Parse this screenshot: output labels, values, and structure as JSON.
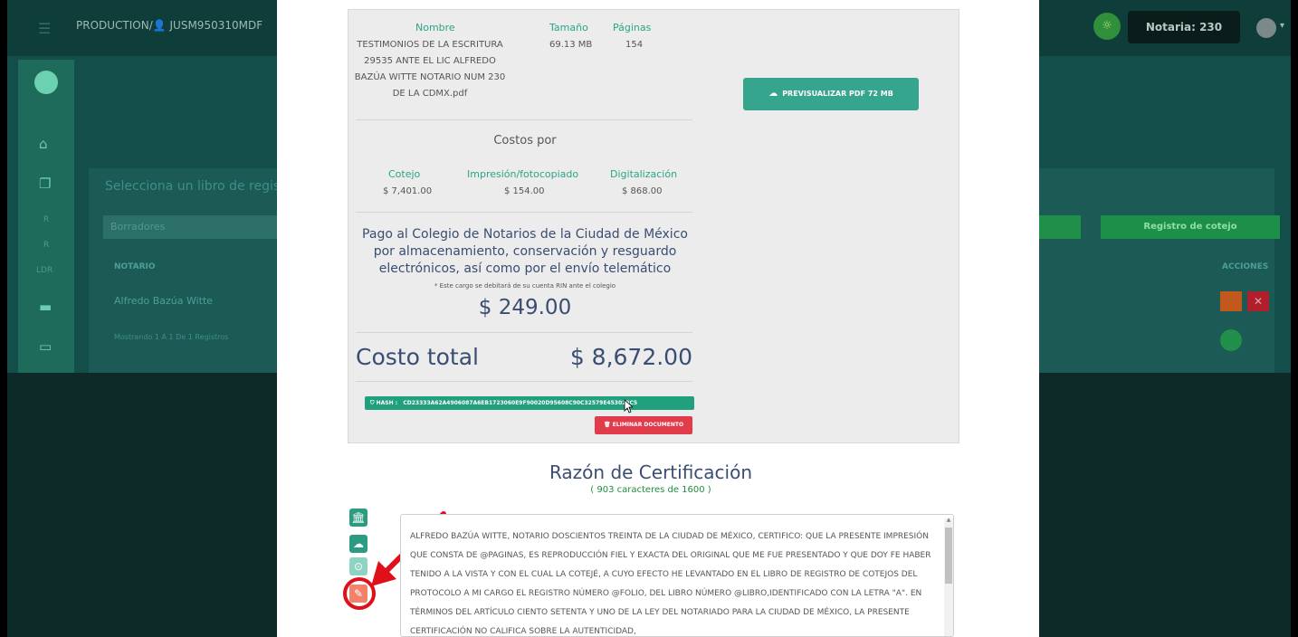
{
  "background": {
    "breadcrumb": "PRODUCTION/👤 JUSM950310MDF",
    "notaria_label": "Notaria: 230",
    "select_label": "Selecciona un libro de regist",
    "input_value": "Borradores",
    "sidebar_labels": [
      "R",
      "R",
      "LDR"
    ],
    "register_button": "Registro de cotejo",
    "col_notario": "NOTARIO",
    "col_acciones": "ACCIONES",
    "row_name": "Alfredo Bazúa Witte",
    "footer_text": "Mostrando 1 A 1 De 1 Registros"
  },
  "document": {
    "headers": {
      "name": "Nombre",
      "size": "Tamaño",
      "pages": "Páginas"
    },
    "file_name": "TESTIMONIOS DE LA ESCRITURA 29535 ANTE EL LIC ALFREDO BAZÚA WITTE NOTARIO NUM 230 DE LA CDMX.pdf",
    "file_size": "69.13 MB",
    "page_count": "154",
    "preview_button": "PREVISUALIZAR PDF 72 MB",
    "costs_title": "Costos por",
    "cost_headers": [
      "Cotejo",
      "Impresión/fotocopiado",
      "Digitalización"
    ],
    "cost_values": [
      "$ 7,401.00",
      "$ 154.00",
      "$ 868.00"
    ],
    "pago_text": "Pago al Colegio de Notarios de la Ciudad de México por almacenamiento, conservación y resguardo electrónicos, así como por el envío telemático",
    "pago_note": "* Este cargo se debitará de su cuenta RIN ante el colegio",
    "pago_amount": "$ 249.00",
    "total_label": "Costo total",
    "total_amount": "$ 8,672.00",
    "hash_label": "HASH :",
    "hash_value": "CD23333A62A4906087A6EB1723060E9F90020D95608C90C32579E453029C5",
    "delete_button": "ELIMINAR DOCUMENTO"
  },
  "razon": {
    "title": "Razón de Certificación",
    "count": "( 903 caracteres de 1600 )",
    "text": "ALFREDO BAZÚA WITTE, NOTARIO DOSCIENTOS TREINTA DE LA CIUDAD DE MÉXICO, CERTIFICO: QUE LA PRESENTE IMPRESIÓN QUE CONSTA DE @PAGINAS, ES REPRODUCCIÓN FIEL Y EXACTA DEL ORIGINAL QUE ME FUE PRESENTADO Y QUE DOY FE HABER TENIDO A LA VISTA Y CON EL CUAL LA COTEJÉ, A CUYO EFECTO HE LEVANTADO EN EL LIBRO DE REGISTRO DE COTEJOS DEL PROTOCOLO A MI CARGO EL REGISTRO NÚMERO @FOLIO, DEL LIBRO NÚMERO @LIBRO,IDENTIFICADO CON LA LETRA \"A\". EN TÉRMINOS DEL ARTÍCULO CIENTO SETENTA Y UNO DE LA LEY DEL NOTARIADO PARA LA CIUDAD DE MÉXICO, LA PRESENTE CERTIFICACIÓN NO CALIFICA SOBRE LA AUTENTICIDAD,"
  },
  "colors": {
    "accent_teal": "#36a58e",
    "danger_red": "#e23b4c",
    "title_navy": "#3a4d73",
    "annotation_red": "#e0101a"
  },
  "icons": [
    "menu-icon",
    "bank-icon",
    "cloud-download-icon",
    "disabled-action-icon",
    "pencil-icon",
    "trash-icon",
    "shield-icon",
    "cloud-upload-icon"
  ]
}
